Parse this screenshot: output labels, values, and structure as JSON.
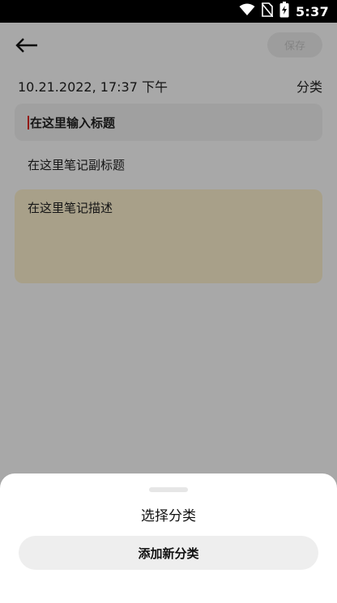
{
  "status_bar": {
    "time": "5:37",
    "icons": [
      "wifi-icon",
      "no-sim-icon",
      "battery-charging-icon"
    ]
  },
  "header": {
    "back_icon": "arrow-left-icon",
    "save_label": "保存"
  },
  "note": {
    "date": "10.21.2022, 17:37 下午",
    "category_label": "分类",
    "title_placeholder": "在这里输入标题",
    "subtitle_placeholder": "在这里笔记副标题",
    "description_placeholder": "在这里笔记描述"
  },
  "sheet": {
    "title": "选择分类",
    "add_button_label": "添加新分类"
  },
  "colors": {
    "description_background": "#fff3d1",
    "overlay": "rgba(0,0,0,0.34)",
    "cursor": "#e0241c"
  }
}
